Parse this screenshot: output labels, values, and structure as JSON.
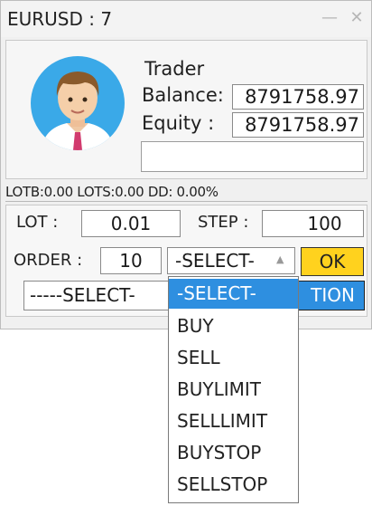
{
  "window": {
    "title": "EURUSD : 7",
    "minimize_glyph": "—",
    "close_glyph": "✕"
  },
  "account": {
    "trader_label": "Trader",
    "balance_label": "Balance:",
    "balance_value": "8791758.97",
    "equity_label": "Equity  :",
    "equity_value": "8791758.97",
    "blank_value": ""
  },
  "status": {
    "text": "LOTB:0.00 LOTS:0.00 DD: 0.00%"
  },
  "controls": {
    "lot_label": "LOT :",
    "lot_value": "0.01",
    "step_label": "STEP :",
    "step_value": "100",
    "order_label": "ORDER :",
    "order_value": "10",
    "order_type_selected": "-SELECT-",
    "ok_label": "OK",
    "action_selected": "-----SELECT-",
    "action_button_label": "TION"
  },
  "dropdown": {
    "options": [
      "-SELECT-",
      "BUY",
      "SELL",
      "BUYLIMIT",
      "SELLLIMIT",
      "BUYSTOP",
      "SELLSTOP"
    ],
    "highlighted": "-SELECT-"
  },
  "colors": {
    "accent_blue": "#2e8fe0",
    "ok_yellow": "#ffd21e",
    "avatar_bg": "#3aa9e8"
  },
  "icons": {
    "avatar": "user-avatar-icon",
    "minimize": "minimize-icon",
    "close": "close-icon",
    "select_arrow": "chevron-up-icon"
  }
}
